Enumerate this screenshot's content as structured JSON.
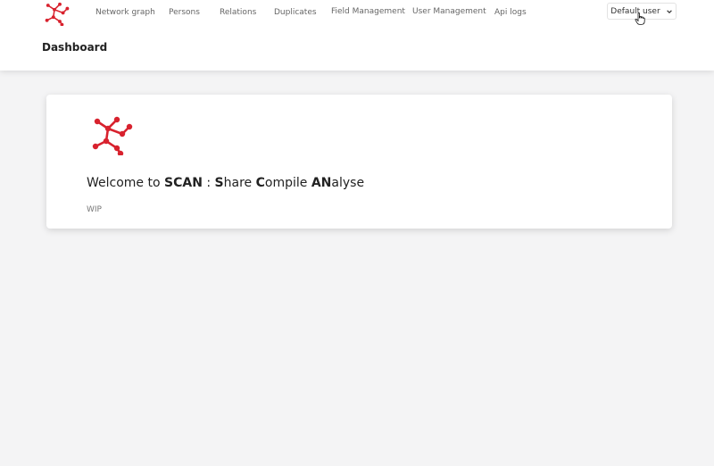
{
  "header": {
    "nav": [
      {
        "label": "Network graph"
      },
      {
        "label": "Persons"
      },
      {
        "label": "Relations"
      },
      {
        "label": "Duplicates"
      },
      {
        "label": "Field Management"
      },
      {
        "label": "User Management"
      },
      {
        "label": "Api logs"
      }
    ],
    "user_menu_label": "Default user",
    "page_title": "Dashboard"
  },
  "card": {
    "welcome_prefix": "Welcome to ",
    "app_name": "SCAN",
    "separator": " : ",
    "acronym_parts": [
      {
        "bold": "S",
        "rest": "hare "
      },
      {
        "bold": "C",
        "rest": "ompile "
      },
      {
        "bold": "AN",
        "rest": "alyse"
      }
    ],
    "status_text": "WIP"
  },
  "colors": {
    "brand": "#d8222e",
    "background": "#f4f4f5"
  },
  "icons": {
    "logo": "scan-network-logo-icon",
    "user_chevron": "chevron-down-icon",
    "cursor": "pointer-hand-icon"
  }
}
